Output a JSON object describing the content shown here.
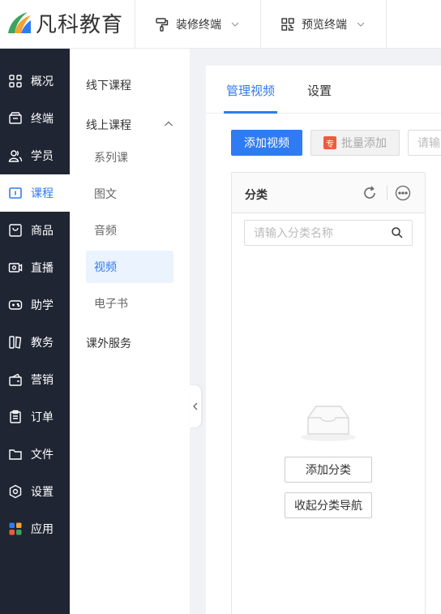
{
  "header": {
    "logo_text": "凡科教育",
    "decorate_label": "装修终端",
    "preview_label": "预览终端"
  },
  "sidebar": {
    "items": [
      {
        "label": "概况",
        "icon": "dashboard-icon"
      },
      {
        "label": "终端",
        "icon": "terminal-icon"
      },
      {
        "label": "学员",
        "icon": "students-icon"
      },
      {
        "label": "课程",
        "icon": "course-icon"
      },
      {
        "label": "商品",
        "icon": "goods-icon"
      },
      {
        "label": "直播",
        "icon": "live-icon"
      },
      {
        "label": "助学",
        "icon": "gamepad-icon"
      },
      {
        "label": "教务",
        "icon": "academic-icon"
      },
      {
        "label": "营销",
        "icon": "marketing-icon"
      },
      {
        "label": "订单",
        "icon": "order-icon"
      },
      {
        "label": "文件",
        "icon": "folder-icon"
      },
      {
        "label": "设置",
        "icon": "settings-icon"
      },
      {
        "label": "应用",
        "icon": "apps-icon"
      }
    ],
    "active_index": 3
  },
  "submenu": {
    "offline": "线下课程",
    "online": "线上课程",
    "children": [
      "系列课",
      "图文",
      "音频",
      "视频",
      "电子书"
    ],
    "active_child": "视频",
    "extra": "课外服务"
  },
  "main": {
    "tabs": [
      "管理视频",
      "设置"
    ],
    "add_video": "添加视频",
    "batch_add": "批量添加",
    "pro_badge": "专",
    "search_placeholder": "请输",
    "category": {
      "title": "分类",
      "search_placeholder": "请输入分类名称",
      "add_category": "添加分类",
      "collapse_nav": "收起分类导航"
    }
  },
  "colors": {
    "accent": "#2f7bf3",
    "sidebar_bg": "#1f2533",
    "pro_badge": "#f05a3c"
  }
}
